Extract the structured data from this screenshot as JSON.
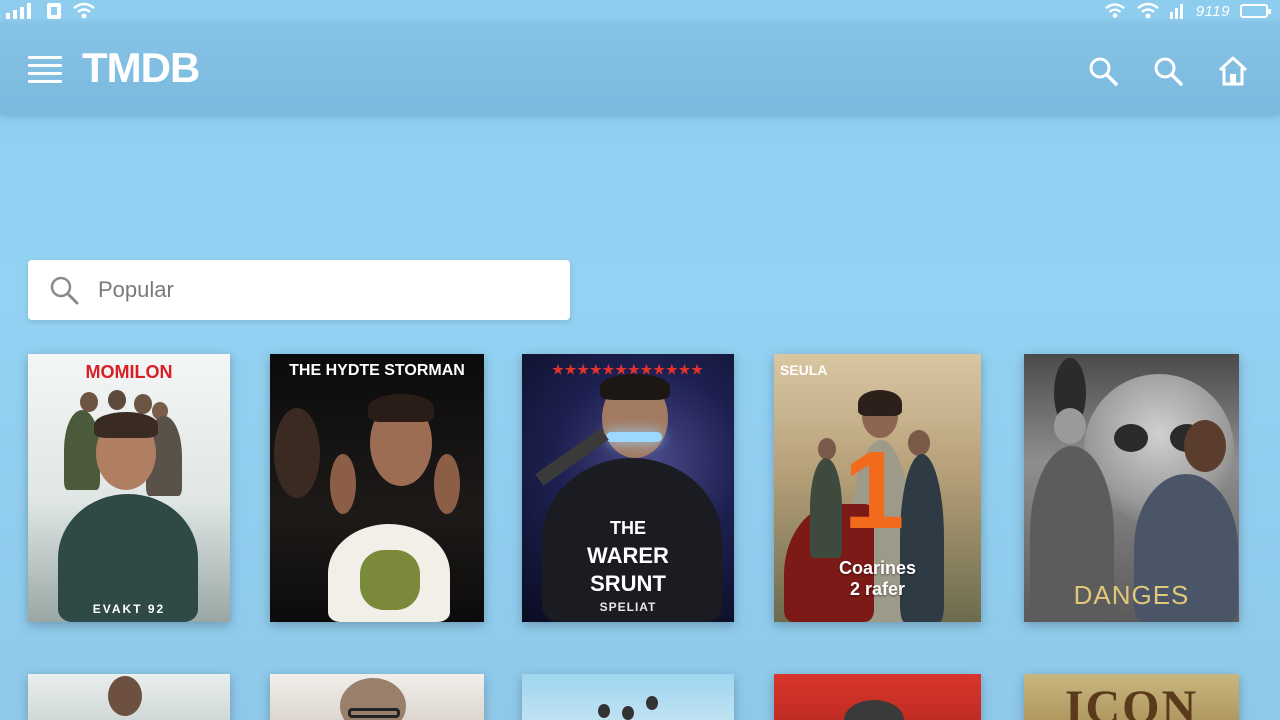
{
  "status_bar": {
    "time": "9119"
  },
  "app_bar": {
    "logo": "TMDB"
  },
  "search": {
    "placeholder": "Popular"
  },
  "posters": [
    {
      "title": "MOMILON",
      "caption": "EVAKT 92"
    },
    {
      "title": "THE HYDTE STORMAN"
    },
    {
      "title": "THE WARER SRUNT",
      "lines": [
        "THE",
        "WARER",
        "SRUNT"
      ],
      "caption": "SPELIAT"
    },
    {
      "title": "SEULA",
      "big_number": "1",
      "lines": [
        "Coarines",
        "2 rafer"
      ]
    },
    {
      "title": "DANGES"
    }
  ],
  "posters_row2": [
    {
      "title": ""
    },
    {
      "title": ""
    },
    {
      "title": ""
    },
    {
      "title": ""
    },
    {
      "title": "ICON"
    }
  ],
  "colors": {
    "background": "#93d2f2",
    "app_bar": "#80bde2",
    "poster1_title": "#d81f26",
    "poster4_number": "#f26a1b",
    "poster5_text": "#e0c77a"
  }
}
